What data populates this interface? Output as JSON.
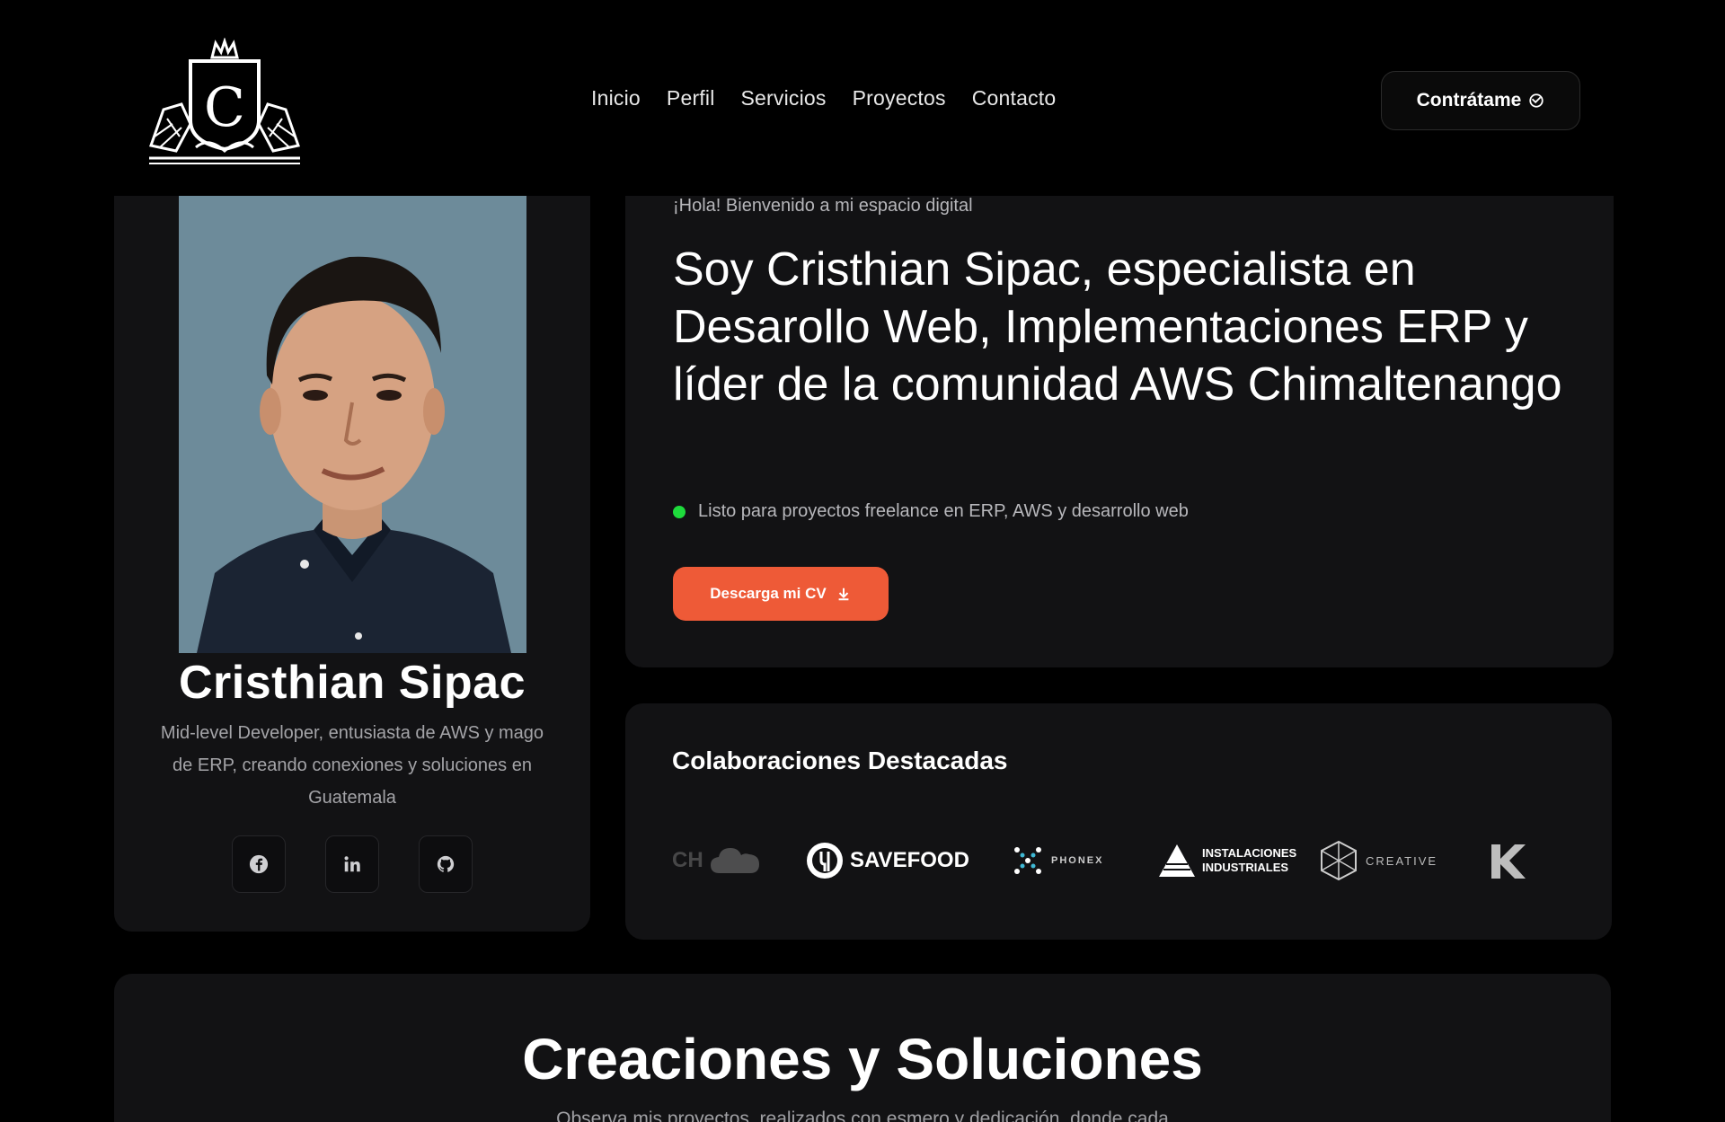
{
  "header": {
    "logo_letter": "C",
    "nav": [
      {
        "label": "Inicio"
      },
      {
        "label": "Perfil"
      },
      {
        "label": "Servicios"
      },
      {
        "label": "Proyectos"
      },
      {
        "label": "Contacto"
      }
    ],
    "hire_label": "Contrátame",
    "hire_icon": "handshake-icon"
  },
  "profile": {
    "name": "Cristhian Sipac",
    "bio": "Mid-level Developer, entusiasta de AWS y mago de ERP, creando conexiones y soluciones en Guatemala",
    "socials": [
      {
        "icon": "facebook-icon"
      },
      {
        "icon": "linkedin-icon"
      },
      {
        "icon": "github-icon"
      }
    ]
  },
  "hero": {
    "greeting": "¡Hola! Bienvenido a mi espacio digital",
    "headline": "Soy Cristhian Sipac, especialista en Desarollo Web, Implementaciones ERP y líder de la comunidad AWS Chimaltenango",
    "availability": "Listo para proyectos freelance en ERP, AWS y desarrollo web",
    "cv_label": "Descarga mi CV",
    "cv_icon": "download-icon"
  },
  "collaborations": {
    "title": "Colaboraciones Destacadas",
    "partners": [
      {
        "name": "CH cloud",
        "text": "CH"
      },
      {
        "name": "SaveFood",
        "text": "SAVEFOOD"
      },
      {
        "name": "Phonex",
        "text": "PHONEX"
      },
      {
        "name": "Instalaciones Industriales",
        "text": "INSTALACIONES\nINDUSTRIALES"
      },
      {
        "name": "Creative",
        "text": "CREATIVE"
      },
      {
        "name": "K logo",
        "text": ""
      }
    ]
  },
  "creations": {
    "title": "Creaciones y Soluciones",
    "subtitle": "Observa mis proyectos, realizados con esmero y dedicación, donde cada"
  },
  "colors": {
    "background": "#000000",
    "card": "#121214",
    "accent": "#ee5a37",
    "status": "#1edb3c"
  }
}
